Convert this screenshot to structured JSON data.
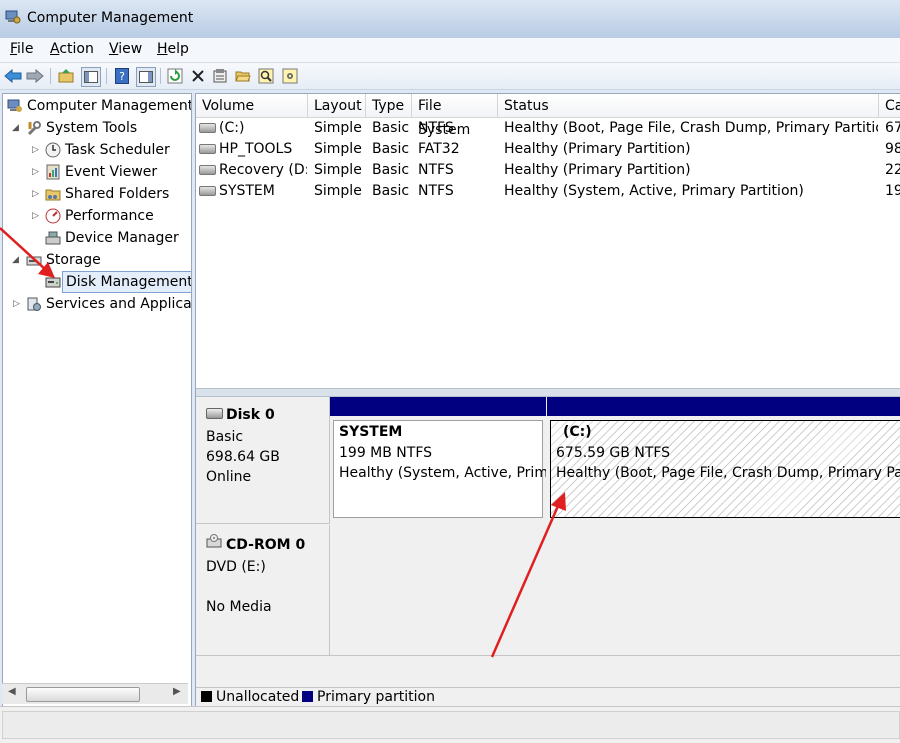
{
  "window": {
    "title": "Computer Management",
    "icon": "computer-management-icon"
  },
  "menu": [
    {
      "key": "F",
      "rest": "ile"
    },
    {
      "key": "A",
      "rest": "ction"
    },
    {
      "key": "V",
      "rest": "iew"
    },
    {
      "key": "H",
      "rest": "elp"
    }
  ],
  "toolbar": [
    "back-arrow-icon",
    "forward-arrow-icon",
    "up-folder-icon",
    "show-hide-tree-icon",
    "help-icon",
    "show-hide-action-pane-icon",
    "refresh-icon",
    "delete-icon",
    "properties-icon",
    "open-icon",
    "search-icon",
    "settings-icon"
  ],
  "tree": {
    "root": "Computer Management",
    "system_tools": "System Tools",
    "task_scheduler": "Task Scheduler",
    "event_viewer": "Event Viewer",
    "shared_folders": "Shared Folders",
    "performance": "Performance",
    "device_manager": "Device Manager",
    "storage": "Storage",
    "disk_management": "Disk Management",
    "services": "Services and Applicat"
  },
  "volumes": {
    "columns": {
      "volume": "Volume",
      "layout": "Layout",
      "type": "Type",
      "fs": "File System",
      "status": "Status",
      "capacity": "Ca"
    },
    "rows": [
      {
        "volume": "(C:)",
        "layout": "Simple",
        "type": "Basic",
        "fs": "NTFS",
        "status": "Healthy (Boot, Page File, Crash Dump, Primary Partition)",
        "capacity": "67"
      },
      {
        "volume": "HP_TOOLS",
        "layout": "Simple",
        "type": "Basic",
        "fs": "FAT32",
        "status": "Healthy (Primary Partition)",
        "capacity": "98"
      },
      {
        "volume": "Recovery (D:)",
        "layout": "Simple",
        "type": "Basic",
        "fs": "NTFS",
        "status": "Healthy (Primary Partition)",
        "capacity": "22"
      },
      {
        "volume": "SYSTEM",
        "layout": "Simple",
        "type": "Basic",
        "fs": "NTFS",
        "status": "Healthy (System, Active, Primary Partition)",
        "capacity": "19"
      }
    ]
  },
  "disk0": {
    "name": "Disk 0",
    "type": "Basic",
    "size": "698.64 GB",
    "state": "Online",
    "partitions": [
      {
        "name": "SYSTEM",
        "size": "199 MB NTFS",
        "status": "Healthy (System, Active, Prima"
      },
      {
        "name": "(C:)",
        "size": "675.59 GB NTFS",
        "status": "Healthy (Boot, Page File, Crash Dump, Primary Partiti"
      }
    ]
  },
  "cdrom0": {
    "name": "CD-ROM 0",
    "drive": "DVD (E:)",
    "media": "No Media"
  },
  "legend": {
    "unallocated": "Unallocated",
    "primary": "Primary partition"
  },
  "colors": {
    "primary": "#000080",
    "unallocated": "#000000",
    "annotation_arrow": "#e02020",
    "selection": "#e4eefb"
  }
}
